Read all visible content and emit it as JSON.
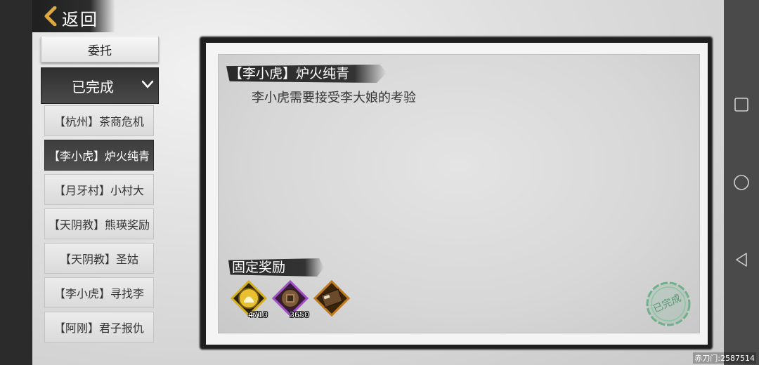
{
  "header": {
    "back_label": "返回"
  },
  "tabs": {
    "top_label": "委托"
  },
  "section": {
    "label": "已完成"
  },
  "quests": [
    {
      "label": "【杭州】茶商危机",
      "selected": false
    },
    {
      "label": "【李小虎】炉火纯青",
      "selected": true
    },
    {
      "label": "【月牙村】小村大",
      "selected": false
    },
    {
      "label": "【天阴教】熊瑛奖励",
      "selected": false
    },
    {
      "label": "【天阴教】圣姑",
      "selected": false
    },
    {
      "label": "【李小虎】寻找李",
      "selected": false
    },
    {
      "label": "【阿刚】君子报仇",
      "selected": false
    }
  ],
  "detail": {
    "title": "【李小虎】炉火纯青",
    "description": "李小虎需要接受李大娘的考验",
    "reward_header": "固定奖励",
    "rewards": [
      {
        "icon": "silver-coin-icon",
        "count": "4710",
        "color": "#d4b020"
      },
      {
        "icon": "copper-coin-icon",
        "count": "3650",
        "color": "#8a3aa0"
      },
      {
        "icon": "book-icon",
        "count": "",
        "color": "#c07a20"
      }
    ],
    "stamp_text": "已完成",
    "stamp_icon": "completed-stamp-icon"
  },
  "system_nav": {
    "recent": "square-icon",
    "home": "circle-icon",
    "back": "triangle-back-icon"
  },
  "watermark": "赤刀门:2587514"
}
